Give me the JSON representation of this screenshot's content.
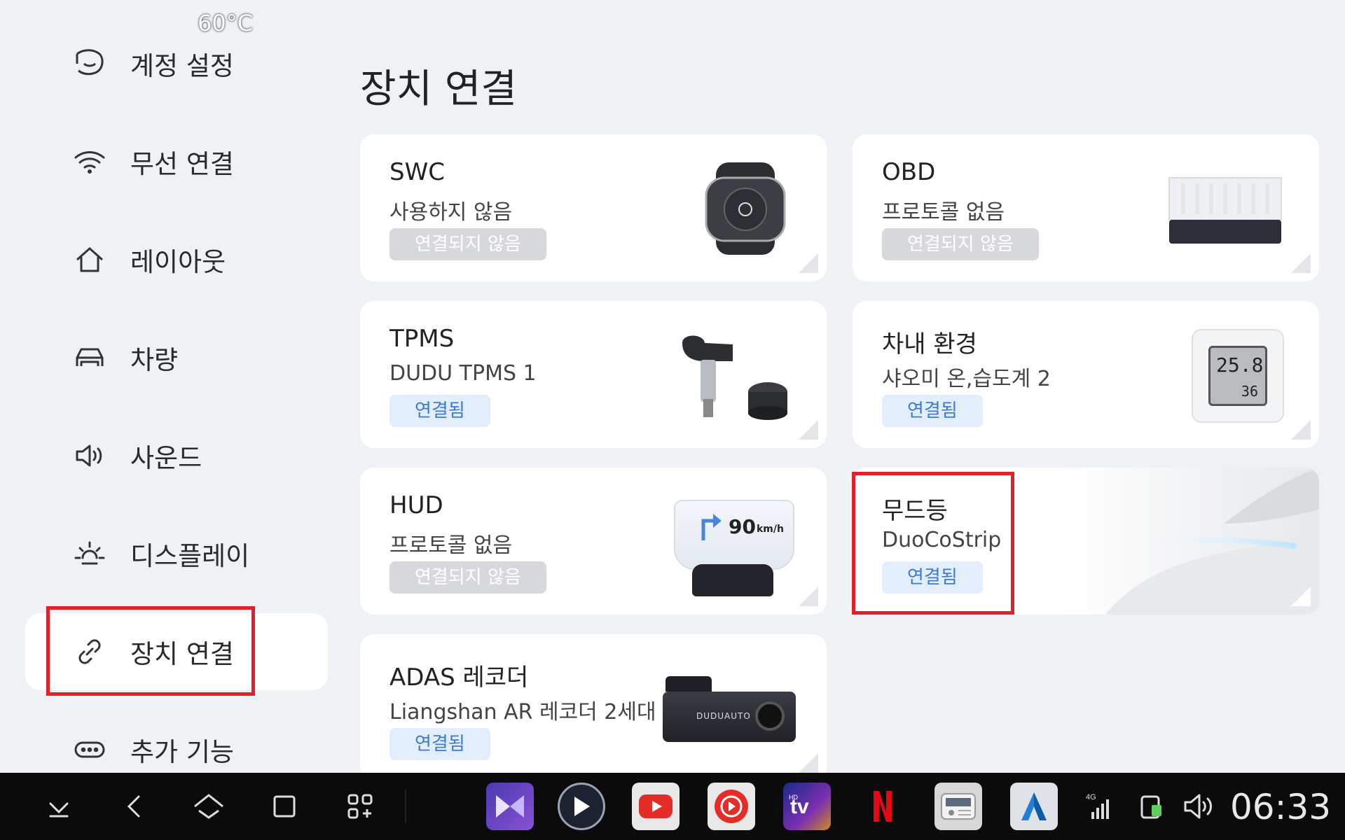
{
  "status": {
    "temperature": "60°C",
    "time": "06:33",
    "network": "4G"
  },
  "page_title": "장치 연결",
  "sidebar": {
    "items": [
      {
        "label": "계정 설정",
        "icon": "account-icon"
      },
      {
        "label": "무선 연결",
        "icon": "wifi-icon"
      },
      {
        "label": "레이아웃",
        "icon": "home-icon"
      },
      {
        "label": "차량",
        "icon": "car-icon"
      },
      {
        "label": "사운드",
        "icon": "speaker-icon"
      },
      {
        "label": "디스플레이",
        "icon": "brightness-icon"
      },
      {
        "label": "장치 연결",
        "icon": "link-icon",
        "active": true
      },
      {
        "label": "추가 기능",
        "icon": "more-icon"
      }
    ]
  },
  "devices": [
    {
      "name": "SWC",
      "sub": "사용하지 않음",
      "status": "연결되지 않음",
      "connected": false
    },
    {
      "name": "OBD",
      "sub": "프로토콜 없음",
      "status": "연결되지 않음",
      "connected": false
    },
    {
      "name": "TPMS",
      "sub": "DUDU TPMS 1",
      "status": "연결됨",
      "connected": true
    },
    {
      "name": "차내 환경",
      "sub": "샤오미 온,습도계 2",
      "status": "연결됨",
      "connected": true,
      "display_temp": "25.8",
      "display_hum": "36"
    },
    {
      "name": "HUD",
      "sub": "프로토콜 없음",
      "status": "연결되지 않음",
      "connected": false,
      "display_speed": "90",
      "display_unit": "km/h"
    },
    {
      "name": "무드등",
      "sub": "DuoCoStrip",
      "status": "연결됨",
      "connected": true
    },
    {
      "name": "ADAS 레코더",
      "sub": "Liangshan AR 레코더 2세대",
      "status": "연결됨",
      "connected": true,
      "brand": "DUDUAUTO"
    }
  ],
  "colors": {
    "accent": "#3b7ad9",
    "badge_on_bg": "#e2eefc",
    "badge_off_bg": "#d6d8dc",
    "highlight": "#e0202a"
  }
}
